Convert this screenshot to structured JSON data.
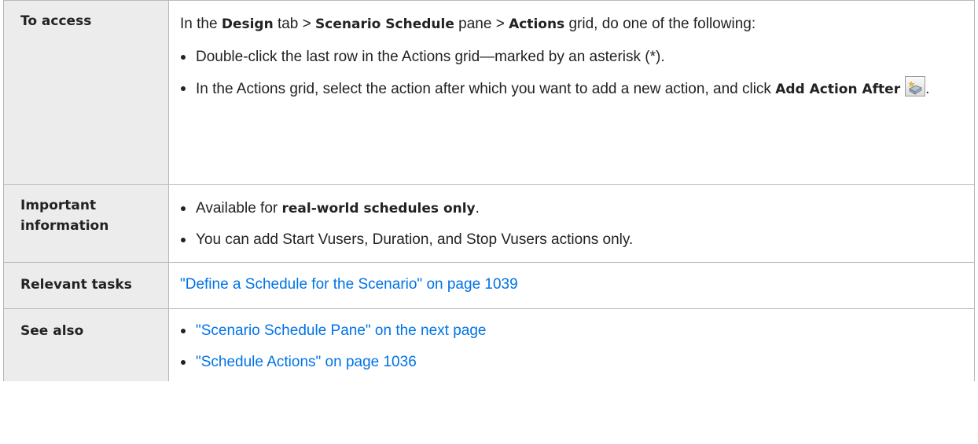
{
  "rows": {
    "access": {
      "label": "To access",
      "intro": {
        "t1": "In the ",
        "b1": "Design",
        "t2": " tab > ",
        "b2": "Scenario Schedule",
        "t3": " pane > ",
        "b3": "Actions",
        "t4": " grid, do one of the following:"
      },
      "bullet1": "Double-click the last row in the Actions grid—marked by an asterisk (*).",
      "bullet2": {
        "text": "In the Actions grid, select the action after which you want to add a new action, and click ",
        "bold": "Add Action After",
        "end": "."
      },
      "icon": "add-action-after-icon"
    },
    "important": {
      "label": "Important information",
      "bullet1": {
        "text": "Available for ",
        "bold": "real-world schedules only",
        "end": "."
      },
      "bullet2": "You can add Start Vusers, Duration, and Stop Vusers actions only."
    },
    "tasks": {
      "label": "Relevant tasks",
      "link": "\"Define a Schedule for the Scenario\" on page 1039"
    },
    "see_also": {
      "label": "See also",
      "link1": "\"Scenario Schedule Pane\" on the next page",
      "link2": "\"Schedule Actions\" on page 1036"
    }
  },
  "colors": {
    "label_background": "#ececec",
    "border": "#b9b9b9",
    "link": "#0073e7",
    "text": "#222222"
  }
}
